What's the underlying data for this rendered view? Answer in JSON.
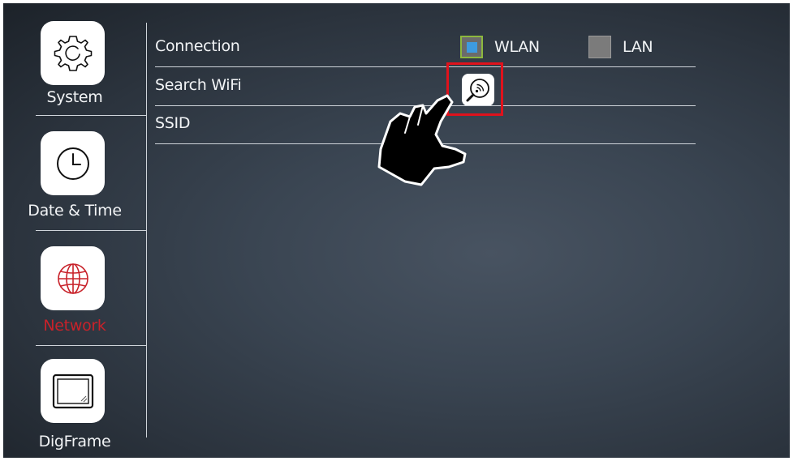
{
  "sidebar": {
    "items": [
      {
        "label": "System",
        "icon": "gear-icon",
        "active": false
      },
      {
        "label": "Date & Time",
        "icon": "clock-icon",
        "active": false
      },
      {
        "label": "Network",
        "icon": "globe-icon",
        "active": true
      },
      {
        "label": "DigFrame",
        "icon": "picture-frame-icon",
        "active": false
      }
    ]
  },
  "main": {
    "connection": {
      "label": "Connection",
      "options": [
        {
          "label": "WLAN",
          "selected": true
        },
        {
          "label": "LAN",
          "selected": false
        }
      ]
    },
    "search_wifi": {
      "label": "Search WiFi",
      "button_icon": "wifi-search-icon"
    },
    "ssid": {
      "label": "SSID",
      "value": ""
    }
  },
  "overlay": {
    "highlight_color": "#e0121c",
    "pointer_icon": "pointing-hand-icon"
  },
  "colors": {
    "active_accent": "#c8222a",
    "radio_selected": "#3d9be0",
    "radio_unselected": "#7b7b7b"
  }
}
